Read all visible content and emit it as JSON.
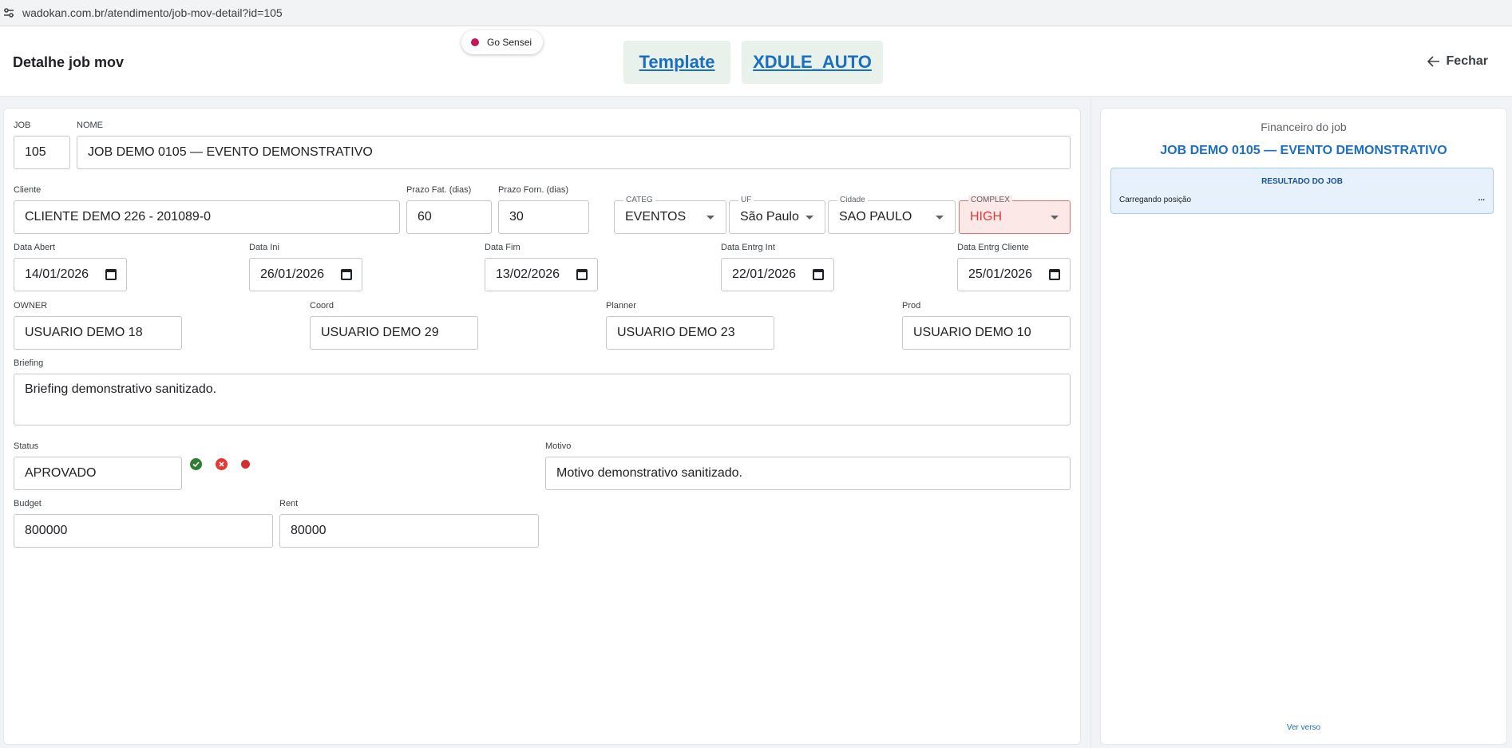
{
  "browser": {
    "url": "wadokan.com.br/atendimento/job-mov-detail?id=105"
  },
  "header": {
    "title": "Detalhe job mov",
    "sensei_label": "Go Sensei",
    "template_label": "Template",
    "xdule_label": "XDULE_AUTO",
    "close_label": "Fechar"
  },
  "form": {
    "job": {
      "label": "JOB",
      "value": "105"
    },
    "nome": {
      "label": "NOME",
      "value": "JOB DEMO 0105 — EVENTO DEMONSTRATIVO"
    },
    "cliente": {
      "label": "Cliente",
      "value": "CLIENTE DEMO 226 - 201089-0"
    },
    "prazo_fat": {
      "label": "Prazo Fat. (dias)",
      "value": "60"
    },
    "prazo_forn": {
      "label": "Prazo Forn. (dias)",
      "value": "30"
    },
    "categ": {
      "label": "CATEG",
      "value": "EVENTOS"
    },
    "uf": {
      "label": "UF",
      "value": "São Paulo"
    },
    "cidade": {
      "label": "Cidade",
      "value": "SAO PAULO"
    },
    "complex": {
      "label": "COMPLEX",
      "value": "HIGH"
    },
    "data_abert": {
      "label": "Data Abert",
      "value": "14/01/2026"
    },
    "data_ini": {
      "label": "Data Ini",
      "value": "26/01/2026"
    },
    "data_fim": {
      "label": "Data Fim",
      "value": "13/02/2026"
    },
    "data_entrg_int": {
      "label": "Data Entrg Int",
      "value": "22/01/2026"
    },
    "data_entrg_cliente": {
      "label": "Data Entrg Cliente",
      "value": "25/01/2026"
    },
    "owner": {
      "label": "OWNER",
      "value": "USUARIO DEMO 18"
    },
    "coord": {
      "label": "Coord",
      "value": "USUARIO DEMO 29"
    },
    "planner": {
      "label": "Planner",
      "value": "USUARIO DEMO 23"
    },
    "prod": {
      "label": "Prod",
      "value": "USUARIO DEMO 10"
    },
    "briefing": {
      "label": "Briefing",
      "value": "Briefing demonstrativo sanitizado."
    },
    "status": {
      "label": "Status",
      "value": "APROVADO"
    },
    "motivo": {
      "label": "Motivo",
      "value": "Motivo demonstrativo sanitizado."
    },
    "budget": {
      "label": "Budget",
      "value": "800000"
    },
    "rent": {
      "label": "Rent",
      "value": "80000"
    }
  },
  "financeiro": {
    "title": "Financeiro do job",
    "job_name": "JOB DEMO 0105 — EVENTO DEMONSTRATIVO",
    "result_title": "RESULTADO DO JOB",
    "loading_text": "Carregando posição",
    "loading_dots": "...",
    "ver_verso": "Ver verso"
  },
  "colors": {
    "accent": "#1a6fc4",
    "approve": "#2e7d32",
    "reject": "#e53935",
    "status_dot": "#d32f2f",
    "error_bg": "#fde8e8"
  }
}
